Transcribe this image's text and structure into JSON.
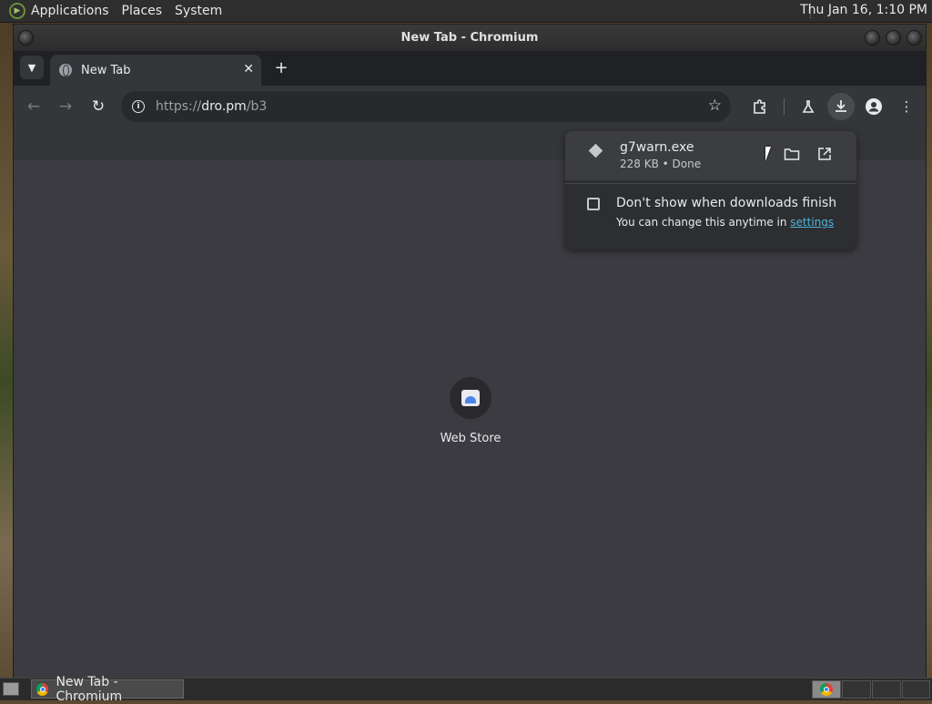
{
  "top_panel": {
    "menus": [
      "Applications",
      "Places",
      "System"
    ],
    "clock": "Thu Jan 16,  1:10 PM"
  },
  "window": {
    "title": "New Tab - Chromium"
  },
  "browser": {
    "tab": {
      "title": "New Tab",
      "close": "✕"
    },
    "new_tab": "+",
    "omnibox": {
      "url_scheme": "https://",
      "url_host": "dro.pm",
      "url_path": "/b3"
    }
  },
  "content": {
    "shortcut_label": "Web Store"
  },
  "downloads": {
    "file_name": "g7warn.exe",
    "file_meta": "228 KB • Done",
    "dont_show_label": "Don't show when downloads finish",
    "hint_prefix": "You can change this anytime in ",
    "hint_link": "settings"
  },
  "taskbar": {
    "task_label": "New Tab - Chromium"
  }
}
